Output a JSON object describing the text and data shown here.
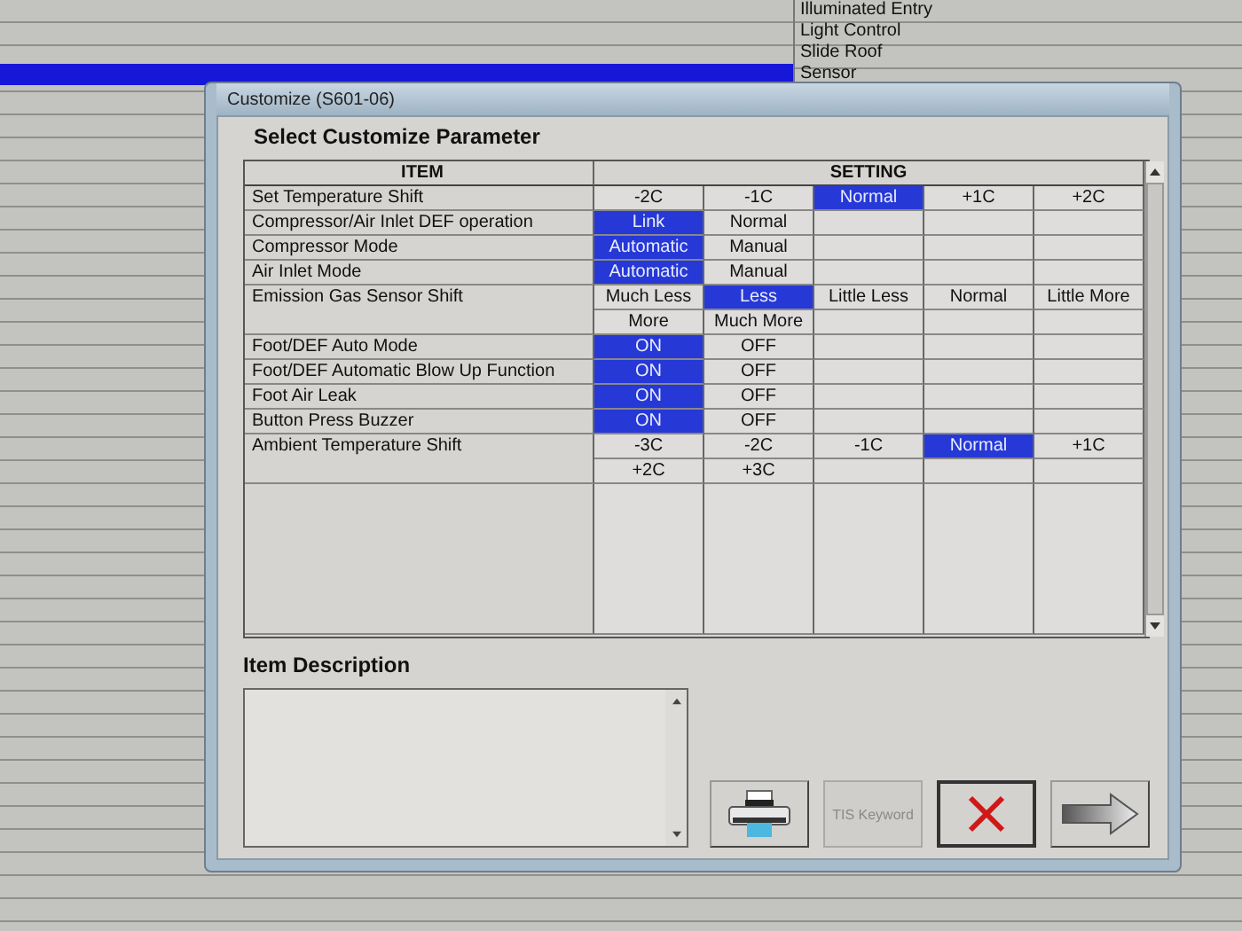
{
  "background_list": [
    {
      "label": "Illuminated Entry",
      "selected": false
    },
    {
      "label": "Light Control",
      "selected": false
    },
    {
      "label": "Slide Roof",
      "selected": false
    },
    {
      "label": "Sensor",
      "selected": true
    }
  ],
  "dialog": {
    "title": "Customize (S601-06)",
    "heading": "Select Customize Parameter",
    "table": {
      "columns": [
        "ITEM",
        "SETTING"
      ],
      "rows": [
        {
          "item": "Set Temperature Shift",
          "options": [
            {
              "label": "-2C",
              "selected": false
            },
            {
              "label": "-1C",
              "selected": false
            },
            {
              "label": "Normal",
              "selected": true
            },
            {
              "label": "+1C",
              "selected": false
            },
            {
              "label": "+2C",
              "selected": false
            }
          ]
        },
        {
          "item": "Compressor/Air Inlet DEF operation",
          "options": [
            {
              "label": "Link",
              "selected": true
            },
            {
              "label": "Normal",
              "selected": false
            }
          ]
        },
        {
          "item": "Compressor Mode",
          "options": [
            {
              "label": "Automatic",
              "selected": true
            },
            {
              "label": "Manual",
              "selected": false
            }
          ]
        },
        {
          "item": "Air Inlet Mode",
          "options": [
            {
              "label": "Automatic",
              "selected": true
            },
            {
              "label": "Manual",
              "selected": false
            }
          ]
        },
        {
          "item": "Emission Gas Sensor Shift",
          "options": [
            {
              "label": "Much Less",
              "selected": false
            },
            {
              "label": "Less",
              "selected": true
            },
            {
              "label": "Little Less",
              "selected": false
            },
            {
              "label": "Normal",
              "selected": false
            },
            {
              "label": "Little More",
              "selected": false
            },
            {
              "label": "More",
              "selected": false
            },
            {
              "label": "Much More",
              "selected": false
            }
          ]
        },
        {
          "item": "Foot/DEF Auto Mode",
          "options": [
            {
              "label": "ON",
              "selected": true
            },
            {
              "label": "OFF",
              "selected": false
            }
          ]
        },
        {
          "item": "Foot/DEF Automatic Blow Up Function",
          "options": [
            {
              "label": "ON",
              "selected": true
            },
            {
              "label": "OFF",
              "selected": false
            }
          ]
        },
        {
          "item": "Foot Air Leak",
          "options": [
            {
              "label": "ON",
              "selected": true
            },
            {
              "label": "OFF",
              "selected": false
            }
          ]
        },
        {
          "item": "Button Press Buzzer",
          "options": [
            {
              "label": "ON",
              "selected": true
            },
            {
              "label": "OFF",
              "selected": false
            }
          ]
        },
        {
          "item": "Ambient Temperature Shift",
          "options": [
            {
              "label": "-3C",
              "selected": false
            },
            {
              "label": "-2C",
              "selected": false
            },
            {
              "label": "-1C",
              "selected": false
            },
            {
              "label": "Normal",
              "selected": true
            },
            {
              "label": "+1C",
              "selected": false
            },
            {
              "label": "+2C",
              "selected": false
            },
            {
              "label": "+3C",
              "selected": false
            }
          ]
        }
      ]
    },
    "description_label": "Item Description",
    "buttons": [
      {
        "kind": "print",
        "disabled": false
      },
      {
        "kind": "text",
        "label": "TIS Keyword",
        "disabled": true
      },
      {
        "kind": "cancel",
        "disabled": false
      },
      {
        "kind": "next",
        "disabled": false
      }
    ]
  }
}
